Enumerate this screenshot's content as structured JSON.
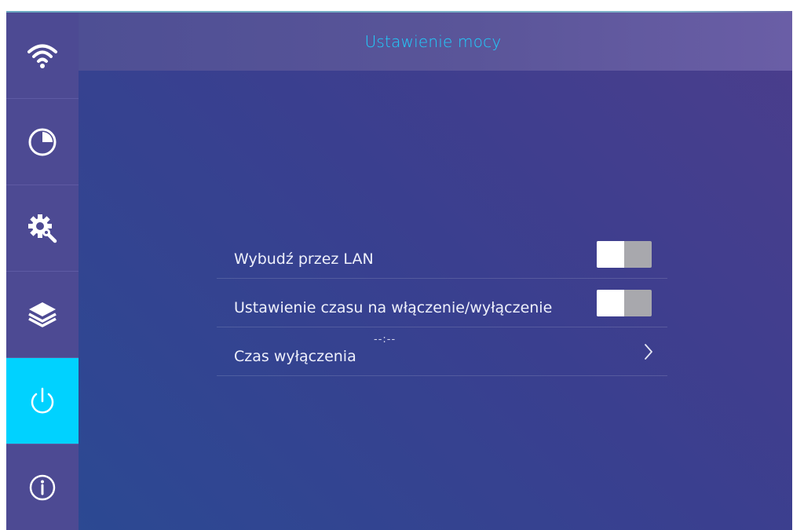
{
  "header": {
    "title": "Ustawienie mocy"
  },
  "sidebar": {
    "items": [
      {
        "icon": "wifi-icon",
        "active": false
      },
      {
        "icon": "clock-icon",
        "active": false
      },
      {
        "icon": "gear-wrench-icon",
        "active": false
      },
      {
        "icon": "layers-icon",
        "active": false
      },
      {
        "icon": "power-icon",
        "active": true
      },
      {
        "icon": "info-icon",
        "active": false
      }
    ]
  },
  "settings": {
    "wake_on_lan": {
      "label": "Wybudź przez LAN",
      "enabled": false
    },
    "power_schedule": {
      "label": "Ustawienie czasu na włączenie/wyłączenie",
      "enabled": false
    },
    "shutdown_time": {
      "label": "Czas wyłączenia",
      "value": "--:--"
    }
  },
  "colors": {
    "accent": "#00d2ff",
    "sidebar": "#4d4a93",
    "header_text": "#1fd0ff",
    "toggle_off": "#a8a8ad"
  }
}
